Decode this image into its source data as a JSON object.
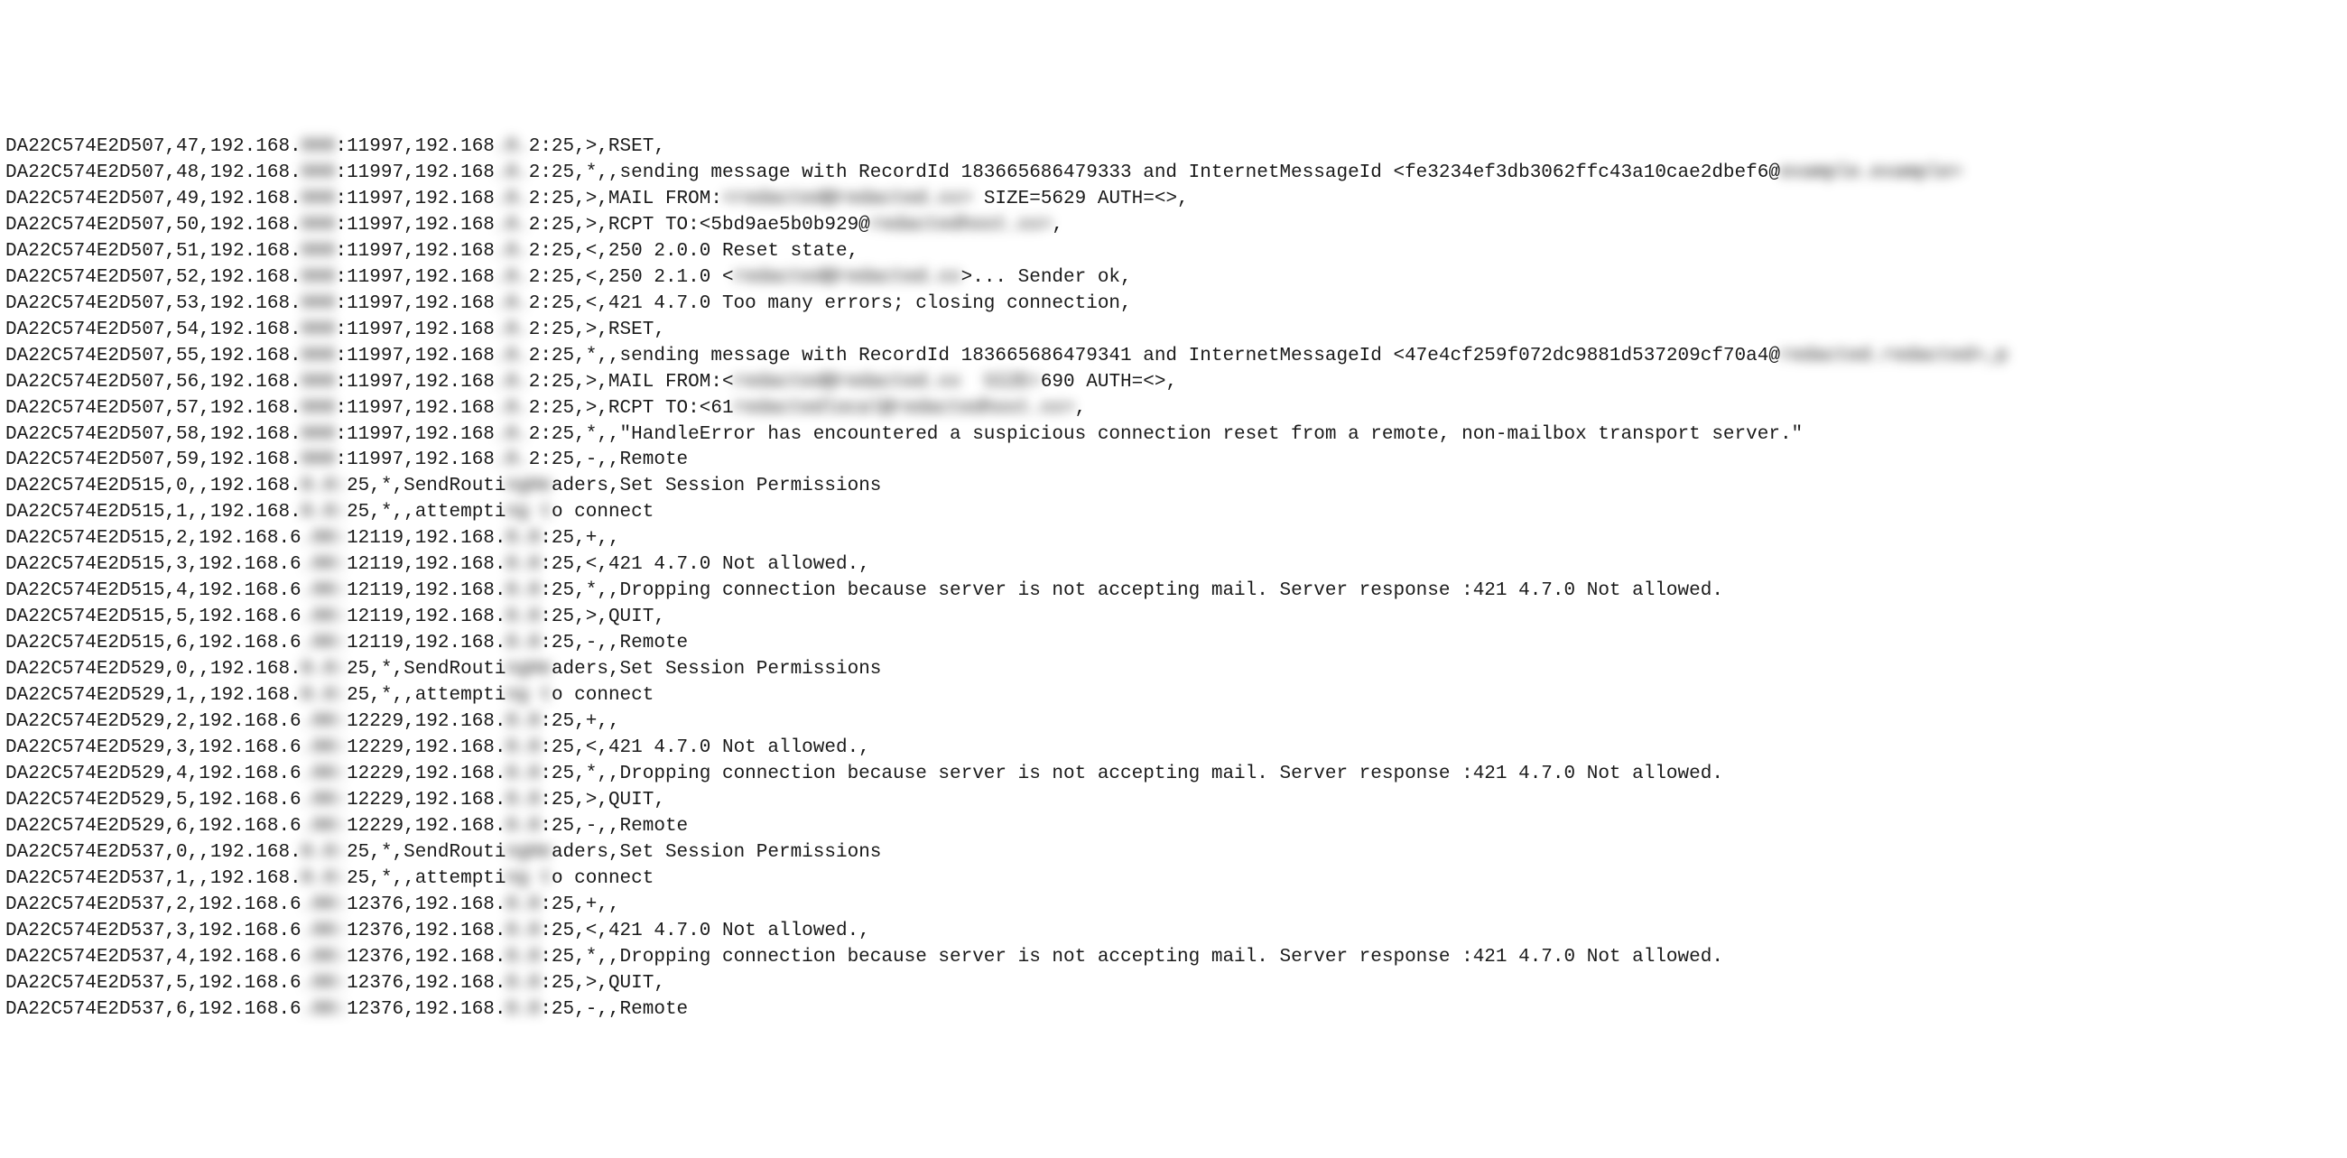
{
  "lines": [
    {
      "segments": [
        {
          "t": "DA22C574E2D507,47,192.168."
        },
        {
          "t": "000",
          "blur": true
        },
        {
          "t": ":11997,192.168"
        },
        {
          "t": ".0.",
          "blur": true
        },
        {
          "t": "2:25,>,RSET,"
        }
      ]
    },
    {
      "segments": [
        {
          "t": "DA22C574E2D507,48,192.168."
        },
        {
          "t": "000",
          "blur": true
        },
        {
          "t": ":11997,192.168"
        },
        {
          "t": ".0.",
          "blur": true
        },
        {
          "t": "2:25,*,,sending message with RecordId 183665686479333 and InternetMessageId <fe3234ef3db3062ffc43a10cae2dbef6@"
        },
        {
          "t": "example.example>",
          "blur": true
        }
      ]
    },
    {
      "segments": [
        {
          "t": "DA22C574E2D507,49,192.168."
        },
        {
          "t": "000",
          "blur": true
        },
        {
          "t": ":11997,192.168"
        },
        {
          "t": ".0.",
          "blur": true
        },
        {
          "t": "2:25,>,MAIL FROM:"
        },
        {
          "t": "<redacted@redacted.xx>",
          "blur": true
        },
        {
          "t": " SIZE=5629 AUTH=<>,"
        }
      ]
    },
    {
      "segments": [
        {
          "t": "DA22C574E2D507,50,192.168."
        },
        {
          "t": "000",
          "blur": true
        },
        {
          "t": ":11997,192.168"
        },
        {
          "t": ".0.",
          "blur": true
        },
        {
          "t": "2:25,>,RCPT TO:<5bd9ae5b0b929@"
        },
        {
          "t": "redactedhost.xx>",
          "blur": true
        },
        {
          "t": ","
        }
      ]
    },
    {
      "segments": [
        {
          "t": "DA22C574E2D507,51,192.168."
        },
        {
          "t": "000",
          "blur": true
        },
        {
          "t": ":11997,192.168"
        },
        {
          "t": ".0.",
          "blur": true
        },
        {
          "t": "2:25,<,250 2.0.0 Reset state,"
        }
      ]
    },
    {
      "segments": [
        {
          "t": "DA22C574E2D507,52,192.168."
        },
        {
          "t": "000",
          "blur": true
        },
        {
          "t": ":11997,192.168"
        },
        {
          "t": ".0.",
          "blur": true
        },
        {
          "t": "2:25,<,250 2.1.0 <"
        },
        {
          "t": "redacted@redacted.xx",
          "blur": true
        },
        {
          "t": ">... Sender ok,"
        }
      ]
    },
    {
      "segments": [
        {
          "t": "DA22C574E2D507,53,192.168."
        },
        {
          "t": "000",
          "blur": true
        },
        {
          "t": ":11997,192.168"
        },
        {
          "t": ".0.",
          "blur": true
        },
        {
          "t": "2:25,<,421 4.7.0 Too many errors; closing connection,"
        }
      ]
    },
    {
      "segments": [
        {
          "t": "DA22C574E2D507,54,192.168."
        },
        {
          "t": "000",
          "blur": true
        },
        {
          "t": ":11997,192.168"
        },
        {
          "t": ".0.",
          "blur": true
        },
        {
          "t": "2:25,>,RSET,"
        }
      ]
    },
    {
      "segments": [
        {
          "t": "DA22C574E2D507,55,192.168."
        },
        {
          "t": "000",
          "blur": true
        },
        {
          "t": ":11997,192.168"
        },
        {
          "t": ".0.",
          "blur": true
        },
        {
          "t": "2:25,*,,sending message with RecordId 183665686479341 and InternetMessageId <47e4cf259f072dc9881d537209cf70a4@"
        },
        {
          "t": "redacted.redacted>,p",
          "blur": true
        }
      ]
    },
    {
      "segments": [
        {
          "t": "DA22C574E2D507,56,192.168."
        },
        {
          "t": "000",
          "blur": true
        },
        {
          "t": ":11997,192.168"
        },
        {
          "t": ".0.",
          "blur": true
        },
        {
          "t": "2:25,>,MAIL FROM:<"
        },
        {
          "t": "redacted@redacted.xx  SIZE=",
          "blur": true
        },
        {
          "t": "690 AUTH=<>,"
        }
      ]
    },
    {
      "segments": [
        {
          "t": "DA22C574E2D507,57,192.168."
        },
        {
          "t": "000",
          "blur": true
        },
        {
          "t": ":11997,192.168"
        },
        {
          "t": ".0.",
          "blur": true
        },
        {
          "t": "2:25,>,RCPT TO:<61"
        },
        {
          "t": "redactedlocal@redactedhost.xx>",
          "blur": true
        },
        {
          "t": ","
        }
      ]
    },
    {
      "segments": [
        {
          "t": "DA22C574E2D507,58,192.168."
        },
        {
          "t": "000",
          "blur": true
        },
        {
          "t": ":11997,192.168"
        },
        {
          "t": ".0.",
          "blur": true
        },
        {
          "t": "2:25,*,,\"HandleError has encountered a suspicious connection reset from a remote, non-mailbox transport server.\""
        }
      ]
    },
    {
      "segments": [
        {
          "t": "DA22C574E2D507,59,192.168."
        },
        {
          "t": "000",
          "blur": true
        },
        {
          "t": ":11997,192.168"
        },
        {
          "t": ".0.",
          "blur": true
        },
        {
          "t": "2:25,-,,Remote"
        }
      ]
    },
    {
      "segments": [
        {
          "t": "DA22C574E2D515,0,,192.168."
        },
        {
          "t": "0.0:",
          "blur": true
        },
        {
          "t": "25,*,SendRouti"
        },
        {
          "t": "ngHe",
          "blur": true
        },
        {
          "t": "aders,Set Session Permissions"
        }
      ]
    },
    {
      "segments": [
        {
          "t": "DA22C574E2D515,1,,192.168."
        },
        {
          "t": "0.0:",
          "blur": true
        },
        {
          "t": "25,*,,attempti"
        },
        {
          "t": "ng t",
          "blur": true
        },
        {
          "t": "o connect"
        }
      ]
    },
    {
      "segments": [
        {
          "t": "DA22C574E2D515,2,192.168.6"
        },
        {
          "t": ".00:",
          "blur": true
        },
        {
          "t": "12119,192.168."
        },
        {
          "t": "0.0",
          "blur": true
        },
        {
          "t": ":25,+,,"
        }
      ]
    },
    {
      "segments": [
        {
          "t": "DA22C574E2D515,3,192.168.6"
        },
        {
          "t": ".00:",
          "blur": true
        },
        {
          "t": "12119,192.168."
        },
        {
          "t": "0.0",
          "blur": true
        },
        {
          "t": ":25,<,421 4.7.0 Not allowed.,"
        }
      ]
    },
    {
      "segments": [
        {
          "t": "DA22C574E2D515,4,192.168.6"
        },
        {
          "t": ".00:",
          "blur": true
        },
        {
          "t": "12119,192.168."
        },
        {
          "t": "0.0",
          "blur": true
        },
        {
          "t": ":25,*,,Dropping connection because server is not accepting mail. Server response :421 4.7.0 Not allowed."
        }
      ]
    },
    {
      "segments": [
        {
          "t": "DA22C574E2D515,5,192.168.6"
        },
        {
          "t": ".00:",
          "blur": true
        },
        {
          "t": "12119,192.168."
        },
        {
          "t": "0.0",
          "blur": true
        },
        {
          "t": ":25,>,QUIT,"
        }
      ]
    },
    {
      "segments": [
        {
          "t": "DA22C574E2D515,6,192.168.6"
        },
        {
          "t": ".00:",
          "blur": true
        },
        {
          "t": "12119,192.168."
        },
        {
          "t": "0.0",
          "blur": true
        },
        {
          "t": ":25,-,,Remote"
        }
      ]
    },
    {
      "segments": [
        {
          "t": "DA22C574E2D529,0,,192.168."
        },
        {
          "t": "0.0:",
          "blur": true
        },
        {
          "t": "25,*,SendRouti"
        },
        {
          "t": "ngHe",
          "blur": true
        },
        {
          "t": "aders,Set Session Permissions"
        }
      ]
    },
    {
      "segments": [
        {
          "t": "DA22C574E2D529,1,,192.168."
        },
        {
          "t": "0.0:",
          "blur": true
        },
        {
          "t": "25,*,,attempti"
        },
        {
          "t": "ng t",
          "blur": true
        },
        {
          "t": "o connect"
        }
      ]
    },
    {
      "segments": [
        {
          "t": "DA22C574E2D529,2,192.168.6"
        },
        {
          "t": ".00:",
          "blur": true
        },
        {
          "t": "12229,192.168."
        },
        {
          "t": "0.0",
          "blur": true
        },
        {
          "t": ":25,+,,"
        }
      ]
    },
    {
      "segments": [
        {
          "t": "DA22C574E2D529,3,192.168.6"
        },
        {
          "t": ".00:",
          "blur": true
        },
        {
          "t": "12229,192.168."
        },
        {
          "t": "0.0",
          "blur": true
        },
        {
          "t": ":25,<,421 4.7.0 Not allowed.,"
        }
      ]
    },
    {
      "segments": [
        {
          "t": "DA22C574E2D529,4,192.168.6"
        },
        {
          "t": ".00:",
          "blur": true
        },
        {
          "t": "12229,192.168."
        },
        {
          "t": "0.0",
          "blur": true
        },
        {
          "t": ":25,*,,Dropping connection because server is not accepting mail. Server response :421 4.7.0 Not allowed."
        }
      ]
    },
    {
      "segments": [
        {
          "t": "DA22C574E2D529,5,192.168.6"
        },
        {
          "t": ".00:",
          "blur": true
        },
        {
          "t": "12229,192.168."
        },
        {
          "t": "0.0",
          "blur": true
        },
        {
          "t": ":25,>,QUIT,"
        }
      ]
    },
    {
      "segments": [
        {
          "t": "DA22C574E2D529,6,192.168.6"
        },
        {
          "t": ".00:",
          "blur": true
        },
        {
          "t": "12229,192.168."
        },
        {
          "t": "0.0",
          "blur": true
        },
        {
          "t": ":25,-,,Remote"
        }
      ]
    },
    {
      "segments": [
        {
          "t": "DA22C574E2D537,0,,192.168."
        },
        {
          "t": "0.0:",
          "blur": true
        },
        {
          "t": "25,*,SendRouti"
        },
        {
          "t": "ngHe",
          "blur": true
        },
        {
          "t": "aders,Set Session Permissions"
        }
      ]
    },
    {
      "segments": [
        {
          "t": "DA22C574E2D537,1,,192.168."
        },
        {
          "t": "0.0:",
          "blur": true
        },
        {
          "t": "25,*,,attempti"
        },
        {
          "t": "ng t",
          "blur": true
        },
        {
          "t": "o connect"
        }
      ]
    },
    {
      "segments": [
        {
          "t": "DA22C574E2D537,2,192.168.6"
        },
        {
          "t": ".00:",
          "blur": true
        },
        {
          "t": "12376,192.168."
        },
        {
          "t": "0.0",
          "blur": true
        },
        {
          "t": ":25,+,,"
        }
      ]
    },
    {
      "segments": [
        {
          "t": "DA22C574E2D537,3,192.168.6"
        },
        {
          "t": ".00:",
          "blur": true
        },
        {
          "t": "12376,192.168."
        },
        {
          "t": "0.0",
          "blur": true
        },
        {
          "t": ":25,<,421 4.7.0 Not allowed.,"
        }
      ]
    },
    {
      "segments": [
        {
          "t": "DA22C574E2D537,4,192.168.6"
        },
        {
          "t": ".00:",
          "blur": true
        },
        {
          "t": "12376,192.168."
        },
        {
          "t": "0.0",
          "blur": true
        },
        {
          "t": ":25,*,,Dropping connection because server is not accepting mail. Server response :421 4.7.0 Not allowed."
        }
      ]
    },
    {
      "segments": [
        {
          "t": "DA22C574E2D537,5,192.168.6"
        },
        {
          "t": ".00:",
          "blur": true
        },
        {
          "t": "12376,192.168."
        },
        {
          "t": "0.0",
          "blur": true
        },
        {
          "t": ":25,>,QUIT,"
        }
      ]
    },
    {
      "segments": [
        {
          "t": "DA22C574E2D537,6,192.168.6"
        },
        {
          "t": ".00:",
          "blur": true
        },
        {
          "t": "12376,192.168."
        },
        {
          "t": "0.0",
          "blur": true
        },
        {
          "t": ":25,-,,Remote"
        }
      ]
    }
  ]
}
